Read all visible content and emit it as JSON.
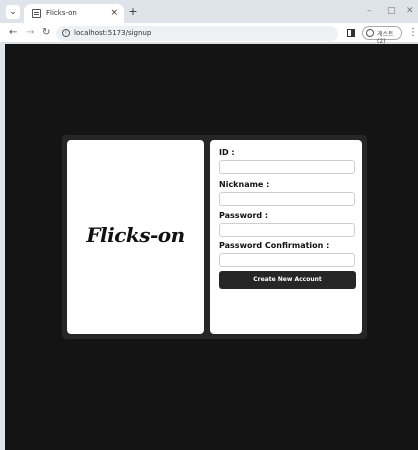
{
  "browser": {
    "tab_title": "Flicks-on",
    "tab_close": "×",
    "new_tab": "+",
    "url": "localhost:5173/signup",
    "profile_label": "게스트(2)",
    "window_minimize": "–",
    "window_maximize": "□",
    "window_close": "✕"
  },
  "logo": {
    "text": "Flicks-on"
  },
  "form": {
    "id_label": "ID :",
    "nickname_label": "Nickname :",
    "password_label": "Password :",
    "password_confirm_label": "Password Confirmation :",
    "submit_label": "Create New Account"
  },
  "colors": {
    "page_background": "#141414",
    "card_background": "#262626",
    "button_background": "#262626"
  }
}
